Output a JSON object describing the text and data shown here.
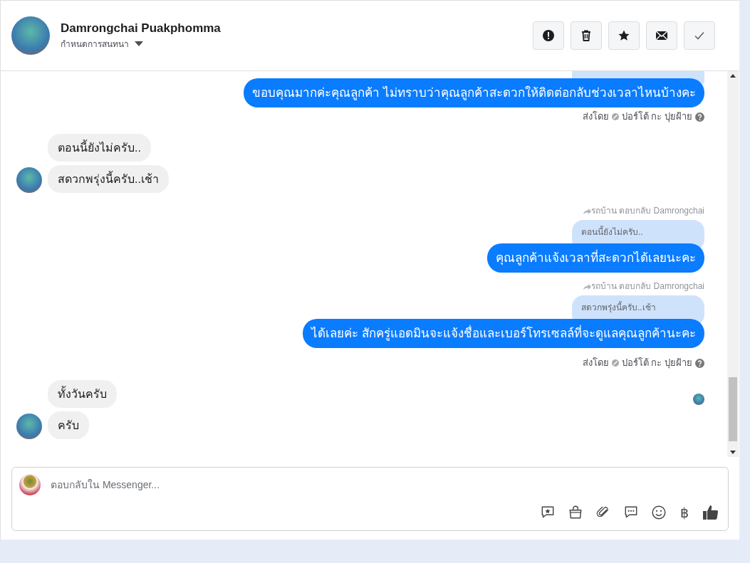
{
  "header": {
    "name": "Damrongchai Puakphomma",
    "subtitle": "กำหนดการสนทนา"
  },
  "messages": [
    {
      "kind": "cut_quote"
    },
    {
      "kind": "outgoing",
      "text": "ขอบคุณมากค่ะคุณลูกค้า ไม่ทราบว่าคุณลูกค้าสะดวกให้ติดต่อกลับช่วงเวลาไหนบ้างคะ"
    },
    {
      "kind": "sent_by",
      "prefix": "ส่งโดย",
      "sender": "ปอร์โต้ กะ ปุยฝ้าย"
    },
    {
      "kind": "incoming",
      "texts": [
        "ตอนนี้ยังไม่ครับ..",
        "สดวกพรุ่งนี้ครับ..เช้า"
      ],
      "seen": false
    },
    {
      "kind": "reply",
      "label": "รถบ้าน ตอบกลับ Damrongchai",
      "quote": "ตอนนี้ยังไม่ครับ..",
      "text": "คุณลูกค้าแจ้งเวลาที่สะดวกได้เลยนะคะ"
    },
    {
      "kind": "reply",
      "label": "รถบ้าน ตอบกลับ Damrongchai",
      "quote": "สดวกพรุ่งนี้ครับ..เช้า",
      "text": "ได้เลยค่ะ สักครู่แอดมินจะแจ้งชื่อและเบอร์โทรเซลล์ที่จะดูแลคุณลูกค้านะคะ"
    },
    {
      "kind": "sent_by",
      "prefix": "ส่งโดย",
      "sender": "ปอร์โต้ กะ ปุยฝ้าย"
    },
    {
      "kind": "incoming",
      "texts": [
        "ทั้งวันครับ",
        "ครับ"
      ],
      "seen": true
    }
  ],
  "composer": {
    "placeholder": "ตอบกลับใน Messenger...",
    "currency_symbol": "฿"
  }
}
